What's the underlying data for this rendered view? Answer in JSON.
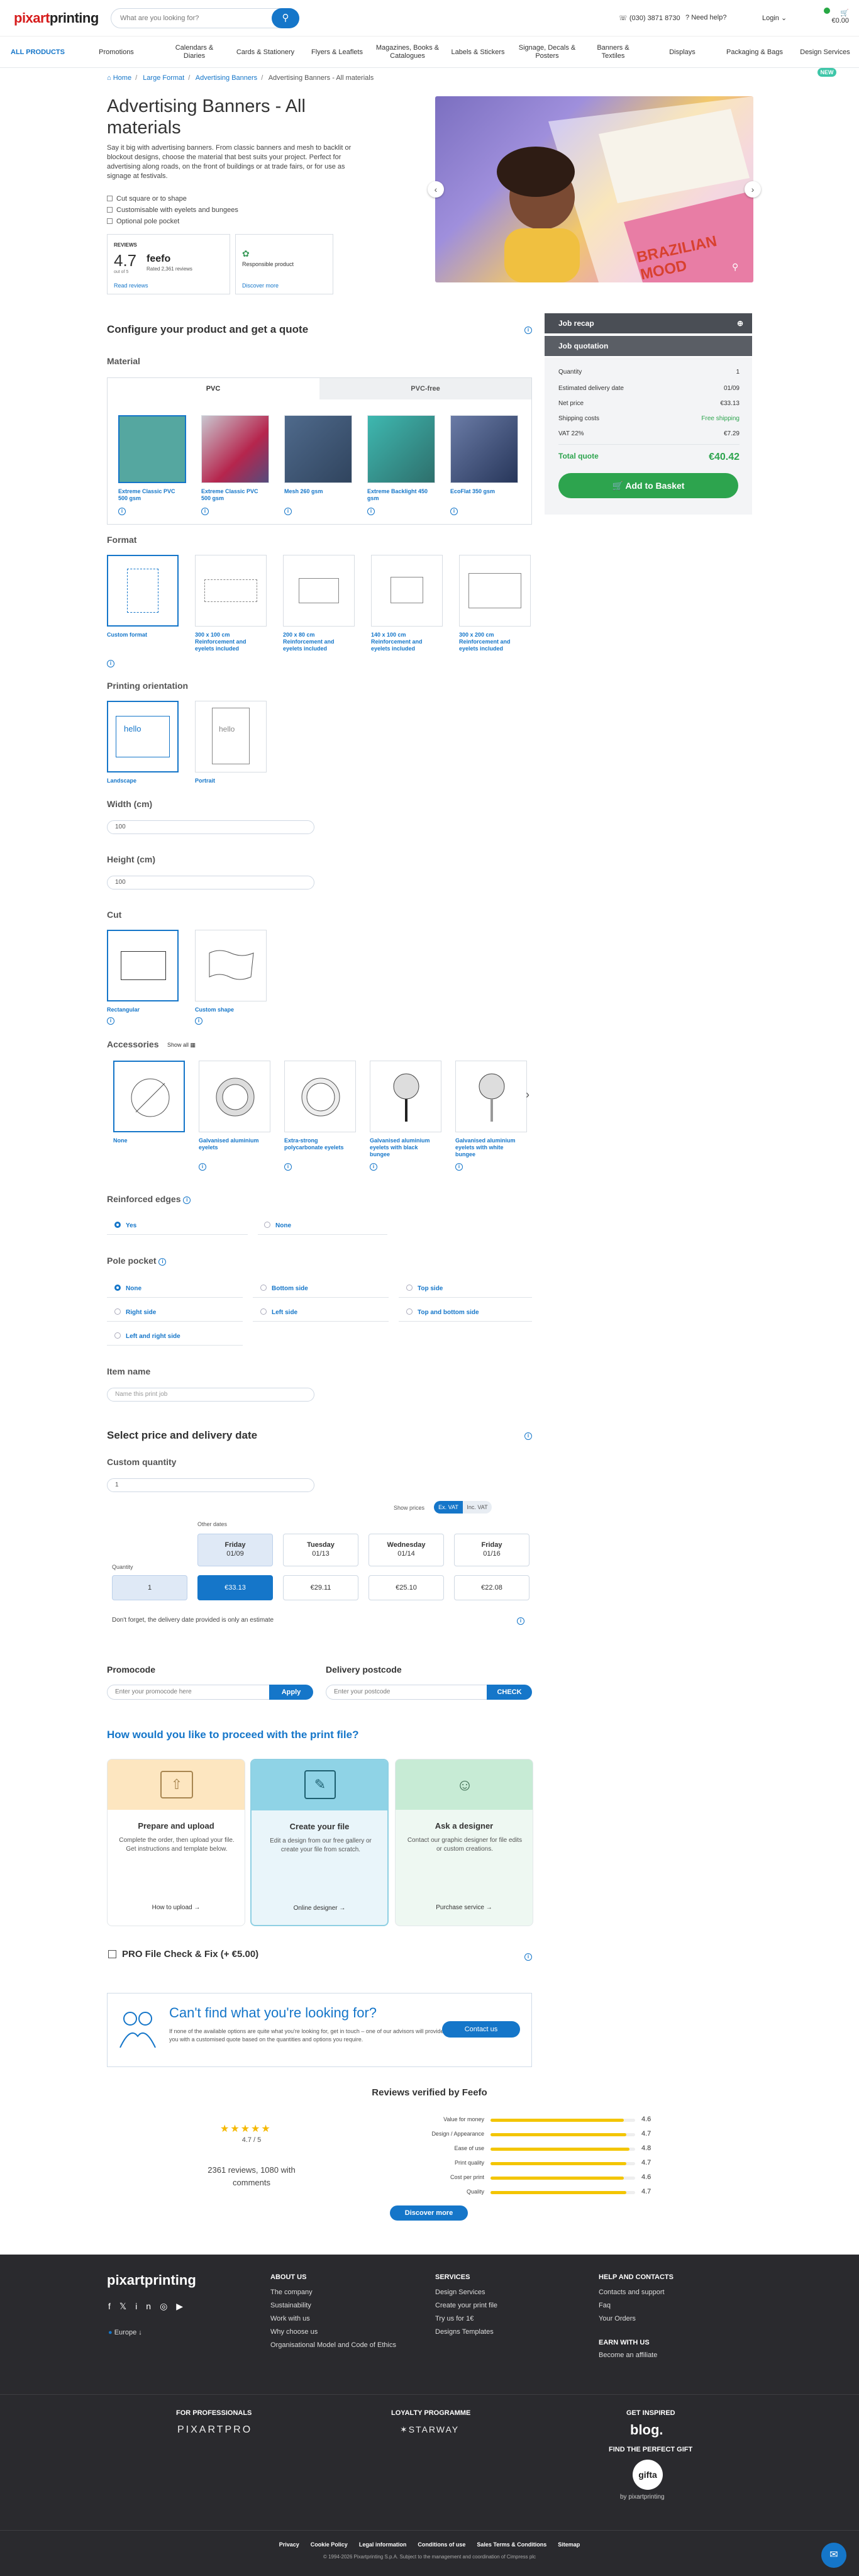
{
  "header": {
    "logo_text": "pixartprinting",
    "search_placeholder": "What are you looking for?",
    "phone": "(030) 3871 8730",
    "need_help": "Need help?",
    "login": "Login",
    "cart_total": "€0.00"
  },
  "nav": {
    "items": [
      "ALL PRODUCTS",
      "Promotions",
      "Calendars & Diaries",
      "Cards & Stationery",
      "Flyers & Leaflets",
      "Magazines, Books & Catalogues",
      "Labels & Stickers",
      "Signage, Decals & Posters",
      "Banners & Textiles",
      "Displays",
      "Packaging & Bags",
      "Design Services"
    ],
    "new_badge": "NEW"
  },
  "breadcrumb": [
    "Home",
    "Large Format",
    "Advertising Banners",
    "Advertising Banners - All materials"
  ],
  "product": {
    "title": "Advertising Banners - All materials",
    "description": "Say it big with advertising banners. From classic banners and mesh to backlit or blockout designs, choose the material that best suits your project. Perfect for advertising along roads, on the front of buildings or at trade fairs, or for use as signage at festivals.",
    "bullets": [
      "Cut square or to shape",
      "Customisable with eyelets and bungees",
      "Optional pole pocket"
    ],
    "reviews_label": "REVIEWS",
    "rating": "4.7",
    "rating_suffix": "out of 5",
    "feefo": "feefo",
    "feefo_sub": "Rated 2,361 reviews",
    "read_reviews": "Read reviews",
    "responsible": "Responsible product",
    "discover_more": "Discover more",
    "image_text": "BRAZILIAN MOOD"
  },
  "config": {
    "title": "Configure your product and get a quote",
    "material_label": "Material",
    "material_tabs": [
      "PVC",
      "PVC-free"
    ],
    "materials": [
      "Extreme Classic PVC 500 gsm",
      "Extreme Classic PVC 500 gsm",
      "Mesh 260 gsm",
      "Extreme Backlight 450 gsm",
      "EcoFlat 350 gsm"
    ],
    "format_label": "Format",
    "formats": [
      "Custom format",
      "300 x 100 cm Reinforcement and eyelets included",
      "200 x 80 cm Reinforcement and eyelets included",
      "140 x 100 cm Reinforcement and eyelets included",
      "300 x 200 cm Reinforcement and eyelets included"
    ],
    "orientation_label": "Printing orientation",
    "orientations": [
      "Landscape",
      "Portrait"
    ],
    "orientation_word": "hello",
    "width_label": "Width (cm)",
    "width_value": "100",
    "height_label": "Height (cm)",
    "height_value": "100",
    "cut_label": "Cut",
    "cuts": [
      "Rectangular",
      "Custom shape"
    ],
    "accessories_label": "Accessories",
    "show_all": "Show all",
    "accessories": [
      "None",
      "Galvanised aluminium eyelets",
      "Extra-strong polycarbonate eyelets",
      "Galvanised aluminium eyelets with black bungee",
      "Galvanised aluminium eyelets with white bungee"
    ],
    "reinforced_label": "Reinforced edges",
    "reinforced_opts": [
      "Yes",
      "None"
    ],
    "pole_label": "Pole pocket",
    "pole_opts": [
      "None",
      "Bottom side",
      "Top side",
      "Right side",
      "Left side",
      "Top and bottom side",
      "Left and right side"
    ],
    "itemname_label": "Item name",
    "itemname_placeholder": "Name this print job"
  },
  "side": {
    "recap": "Job recap",
    "quotation": "Job quotation",
    "rows": [
      {
        "k": "Quantity",
        "v": "1"
      },
      {
        "k": "Estimated delivery date",
        "v": "01/09"
      },
      {
        "k": "Net price",
        "v": "€33.13"
      },
      {
        "k": "Shipping costs",
        "v": "Free shipping"
      },
      {
        "k": "VAT 22%",
        "v": "€7.29"
      }
    ],
    "total_label": "Total quote",
    "total_value": "€40.42",
    "add_button": "Add to Basket"
  },
  "delivery": {
    "title": "Select price and delivery date",
    "custom_qty": "Custom quantity",
    "qty_value": "1",
    "show_prices": "Show prices",
    "vat_toggle": [
      "Ex. VAT",
      "Inc. VAT"
    ],
    "other_dates": "Other dates",
    "quantity_label": "Quantity",
    "dates": [
      {
        "day": "Friday",
        "date": "01/09"
      },
      {
        "day": "Tuesday",
        "date": "01/13"
      },
      {
        "day": "Wednesday",
        "date": "01/14"
      },
      {
        "day": "Friday",
        "date": "01/16"
      }
    ],
    "qty_row": "1",
    "prices": [
      "€33.13",
      "€29.11",
      "€25.10",
      "€22.08"
    ],
    "note": "Don't forget, the delivery date provided is only an estimate",
    "promocode_label": "Promocode",
    "promocode_placeholder": "Enter your promocode here",
    "apply": "Apply",
    "postcode_label": "Delivery postcode",
    "postcode_placeholder": "Enter your postcode",
    "check": "CHECK"
  },
  "proceed": {
    "title": "How would you like to proceed with the print file?",
    "cards": [
      {
        "title": "Prepare and upload",
        "text": "Complete the order, then upload your file. Get instructions and template below.",
        "link": "How to upload"
      },
      {
        "title": "Create your file",
        "text": "Edit a design from our free gallery or create your file from scratch.",
        "link": "Online designer"
      },
      {
        "title": "Ask a designer",
        "text": "Contact our graphic designer for file edits or custom creations.",
        "link": "Purchase service"
      }
    ],
    "pro_check": "PRO File Check & Fix (+ €5.00)"
  },
  "cant_find": {
    "title": "Can't find what you're looking for?",
    "text": "If none of the available options are quite what you're looking for, get in touch – one of our advisors will provide you with a customised quote based on the quantities and options you require.",
    "button": "Contact us"
  },
  "reviews": {
    "title": "Reviews verified by Feefo",
    "score": "4.7 / 5",
    "count_text": "2361 reviews, 1080 with comments",
    "criteria": [
      {
        "name": "Value for money",
        "score": "4.6",
        "level": 0.92
      },
      {
        "name": "Design / Appearance",
        "score": "4.7",
        "level": 0.94
      },
      {
        "name": "Ease of use",
        "score": "4.8",
        "level": 0.96
      },
      {
        "name": "Print quality",
        "score": "4.7",
        "level": 0.94
      },
      {
        "name": "Cost per print",
        "score": "4.6",
        "level": 0.92
      },
      {
        "name": "Quality",
        "score": "4.7",
        "level": 0.94
      }
    ],
    "button": "Discover more"
  },
  "footer": {
    "logo": "pixartprinting",
    "region": "Europe",
    "cols": [
      {
        "title": "ABOUT US",
        "items": [
          "The company",
          "Sustainability",
          "Work with us",
          "Why choose us",
          "Organisational Model and Code of Ethics"
        ]
      },
      {
        "title": "SERVICES",
        "items": [
          "Design Services",
          "Create your print file",
          "Try us for 1€",
          "Designs Templates"
        ]
      },
      {
        "title": "HELP AND CONTACTS",
        "items": [
          "Contacts and support",
          "Faq",
          "Your Orders"
        ]
      }
    ],
    "earn_title": "EARN WITH US",
    "earn_item": "Become an affiliate",
    "pro_label": "FOR PROFESSIONALS",
    "pro_logo": "PIXARTPRO",
    "loyalty_label": "LOYALTY PROGRAMME",
    "loyalty_logo": "STARWAY",
    "inspired_label": "GET INSPIRED",
    "blog_logo": "blog.",
    "gift_label": "FIND THE PERFECT GIFT",
    "gift_logo": "gifta",
    "gift_sub": "by pixartprinting",
    "legal": [
      "Privacy",
      "Cookie Policy",
      "Legal information",
      "Conditions of use",
      "Sales Terms & Conditions",
      "Sitemap"
    ],
    "copyright": "© 1994-2026 Pixartprinting S.p.A. Subject to the management and coordination of Cimpress plc"
  },
  "colors": {
    "accent": "#1576c9",
    "green": "#2da44e",
    "dark": "#2a2a2e"
  }
}
